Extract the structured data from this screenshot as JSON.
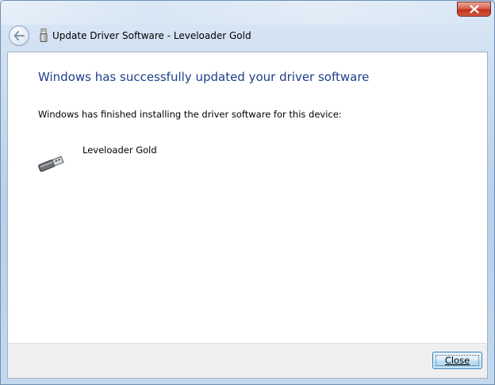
{
  "window": {
    "title": "Update Driver Software - Leveloader Gold",
    "close_icon": "close-icon"
  },
  "nav": {
    "back_icon": "back-arrow-icon"
  },
  "content": {
    "heading": "Windows has successfully updated your driver software",
    "description": "Windows has finished installing the driver software for this device:",
    "device": {
      "icon": "usb-device-icon",
      "name": "Leveloader Gold"
    }
  },
  "footer": {
    "close_label": "Close"
  },
  "colors": {
    "heading": "#1e3f8a",
    "close_button_red": "#c2331a"
  }
}
